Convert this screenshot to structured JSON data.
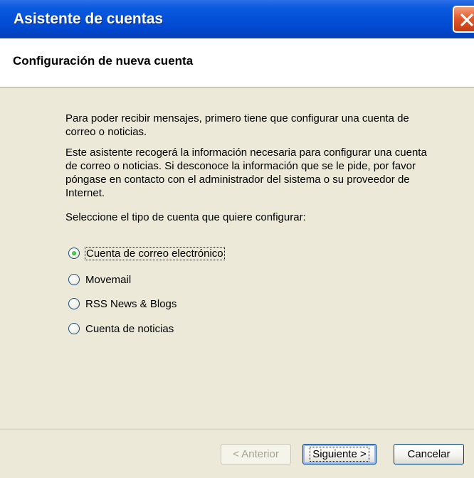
{
  "window": {
    "title": "Asistente de cuentas",
    "close_icon": "close-icon"
  },
  "header": {
    "title": "Configuración de nueva cuenta"
  },
  "intro": {
    "paragraph1": "Para poder recibir mensajes, primero tiene que configurar una cuenta de correo o noticias.",
    "paragraph2": "Este asistente recogerá la información necesaria para configurar una cuenta de correo o noticias. Si desconoce la información que se le pide, por favor póngase en contacto con el administrador del sistema o su proveedor de Internet.",
    "prompt": "Seleccione el tipo de cuenta que quiere configurar:"
  },
  "account_types": {
    "selected": "Cuenta de correo electrónico",
    "options": [
      {
        "label": "Cuenta de correo electrónico",
        "checked": true
      },
      {
        "label": "Movemail",
        "checked": false
      },
      {
        "label": "RSS News & Blogs",
        "checked": false
      },
      {
        "label": "Cuenta de noticias",
        "checked": false
      }
    ]
  },
  "buttons": {
    "prev": "< Anterior",
    "next": "Siguiente >",
    "cancel": "Cancelar"
  },
  "colors": {
    "titlebar": "#0450d8",
    "dialog_bg": "#ece9d8",
    "radio_dot": "#21a121",
    "close_button": "#e35a2c"
  }
}
